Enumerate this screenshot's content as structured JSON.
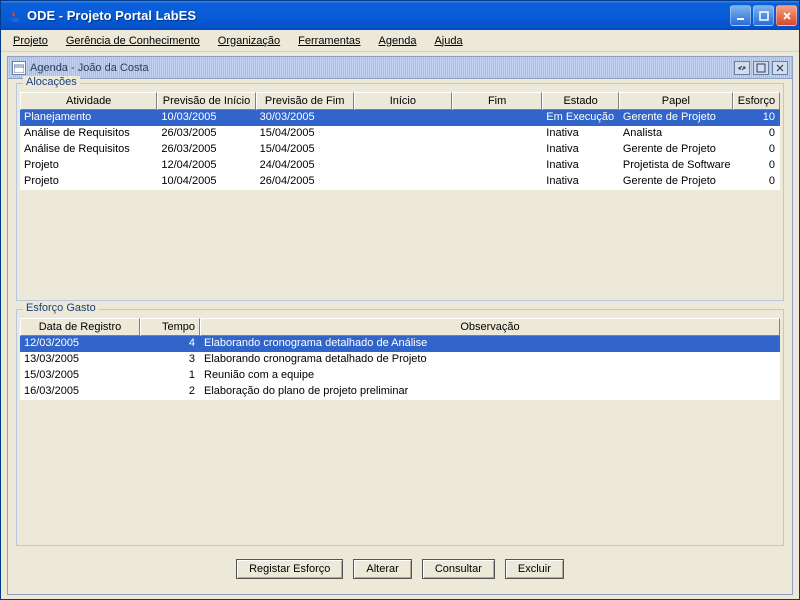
{
  "window": {
    "title": "ODE  - Projeto Portal LabES"
  },
  "menu": {
    "projeto": "Projeto",
    "gerencia": "Gerência de Conhecimento",
    "organizacao": "Organização",
    "ferramentas": "Ferramentas",
    "agenda": "Agenda",
    "ajuda": "Ajuda"
  },
  "internal": {
    "title": "Agenda - João da Costa"
  },
  "alocacoes": {
    "legend": "Alocações",
    "columns": [
      "Atividade",
      "Previsão de Início",
      "Previsão de Fim",
      "Início",
      "Fim",
      "Estado",
      "Papel",
      "Esforço"
    ],
    "rows": [
      {
        "atividade": "Planejamento",
        "prev_inicio": "10/03/2005",
        "prev_fim": "30/03/2005",
        "inicio": "",
        "fim": "",
        "estado": "Em Execução",
        "papel": "Gerente de Projeto",
        "esforco": "10",
        "selected": true
      },
      {
        "atividade": "Análise de Requisitos",
        "prev_inicio": "26/03/2005",
        "prev_fim": "15/04/2005",
        "inicio": "",
        "fim": "",
        "estado": "Inativa",
        "papel": "Analista",
        "esforco": "0",
        "selected": false
      },
      {
        "atividade": "Análise de Requisitos",
        "prev_inicio": "26/03/2005",
        "prev_fim": "15/04/2005",
        "inicio": "",
        "fim": "",
        "estado": "Inativa",
        "papel": "Gerente de Projeto",
        "esforco": "0",
        "selected": false
      },
      {
        "atividade": "Projeto",
        "prev_inicio": "12/04/2005",
        "prev_fim": "24/04/2005",
        "inicio": "",
        "fim": "",
        "estado": "Inativa",
        "papel": "Projetista de Software",
        "esforco": "0",
        "selected": false
      },
      {
        "atividade": "Projeto",
        "prev_inicio": "10/04/2005",
        "prev_fim": "26/04/2005",
        "inicio": "",
        "fim": "",
        "estado": "Inativa",
        "papel": "Gerente de Projeto",
        "esforco": "0",
        "selected": false
      }
    ]
  },
  "esforco": {
    "legend": "Esforço Gasto",
    "columns": [
      "Data de Registro",
      "Tempo",
      "Observação"
    ],
    "rows": [
      {
        "data": "12/03/2005",
        "tempo": "4",
        "obs": "Elaborando cronograma detalhado de Análise",
        "selected": true
      },
      {
        "data": "13/03/2005",
        "tempo": "3",
        "obs": "Elaborando cronograma detalhado de Projeto",
        "selected": false
      },
      {
        "data": "15/03/2005",
        "tempo": "1",
        "obs": "Reunião com a equipe",
        "selected": false
      },
      {
        "data": "16/03/2005",
        "tempo": "2",
        "obs": "Elaboração do plano de projeto preliminar",
        "selected": false
      }
    ]
  },
  "buttons": {
    "registrar": "Registar Esforço",
    "alterar": "Alterar",
    "consultar": "Consultar",
    "excluir": "Excluir"
  }
}
